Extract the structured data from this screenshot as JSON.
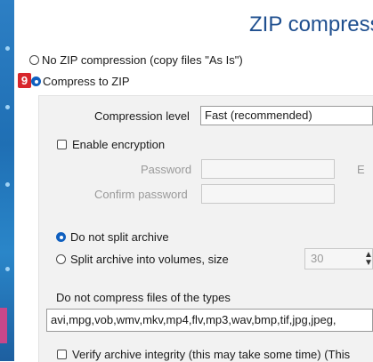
{
  "title": "ZIP compress",
  "step_badge": "9",
  "no_zip_label": "No ZIP compression (copy files \"As Is\")",
  "compress_zip_label": "Compress to ZIP",
  "compression_level": {
    "label": "Compression level",
    "value": "Fast (recommended)"
  },
  "enable_encryption_label": "Enable encryption",
  "password_label": "Password",
  "confirm_password_label": "Confirm password",
  "password_hint_partial": "E",
  "split": {
    "do_not_split_label": "Do not split archive",
    "split_volumes_label": "Split archive into volumes, size",
    "size_value": "30"
  },
  "exclude_types": {
    "label": "Do not compress files of the types",
    "value": "avi,mpg,vob,wmv,mkv,mp4,flv,mp3,wav,bmp,tif,jpg,jpeg,"
  },
  "verify_label": "Verify archive integrity (this may take some time) (This",
  "colors": {
    "title": "#1f4f8f",
    "radio_selected": "#0f5fbf",
    "badge": "#d8262c",
    "side_strip": "#2d7fc4"
  }
}
